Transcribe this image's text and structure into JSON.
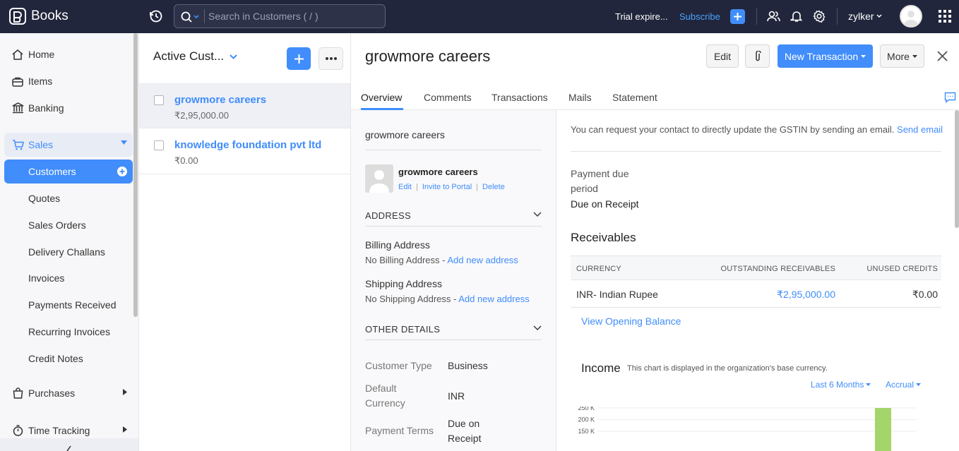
{
  "app": {
    "name": "Books"
  },
  "search": {
    "placeholder": "Search in Customers ( / )"
  },
  "header": {
    "trial": "Trial expire...",
    "subscribe": "Subscribe",
    "org": "zylker"
  },
  "sidebar": {
    "items": [
      {
        "label": "Home"
      },
      {
        "label": "Items"
      },
      {
        "label": "Banking"
      },
      {
        "label": "Sales"
      },
      {
        "label": "Customers"
      },
      {
        "label": "Quotes"
      },
      {
        "label": "Sales Orders"
      },
      {
        "label": "Delivery Challans"
      },
      {
        "label": "Invoices"
      },
      {
        "label": "Payments Received"
      },
      {
        "label": "Recurring Invoices"
      },
      {
        "label": "Credit Notes"
      },
      {
        "label": "Purchases"
      },
      {
        "label": "Time Tracking"
      }
    ]
  },
  "list": {
    "title": "Active Cust...",
    "rows": [
      {
        "name": "growmore careers",
        "amount": "₹2,95,000.00"
      },
      {
        "name": "knowledge foundation pvt ltd",
        "amount": "₹0.00"
      }
    ]
  },
  "detail": {
    "title": "growmore careers",
    "buttons": {
      "edit": "Edit",
      "new_transaction": "New Transaction",
      "more": "More"
    },
    "tabs": [
      "Overview",
      "Comments",
      "Transactions",
      "Mails",
      "Statement"
    ],
    "left": {
      "name": "growmore careers",
      "contact_name": "growmore careers",
      "contact_links": {
        "edit": "Edit",
        "invite": "Invite to Portal",
        "delete": "Delete"
      },
      "address_header": "ADDRESS",
      "billing_label": "Billing Address",
      "billing_text": "No Billing Address -",
      "shipping_label": "Shipping Address",
      "shipping_text": "No Shipping Address -",
      "add_new_address": "Add new address",
      "other_header": "OTHER DETAILS",
      "customer_type_label": "Customer Type",
      "customer_type": "Business",
      "default_currency_label": "Default Currency",
      "default_currency": "INR",
      "payment_terms_label": "Payment Terms",
      "payment_terms": "Due on Receipt"
    },
    "right": {
      "gstin_note": "You can request your contact to directly update the GSTIN by sending an email.",
      "send_email": "Send email",
      "payment_due_label": "Payment due period",
      "payment_due_value": "Due on Receipt",
      "receivables_title": "Receivables",
      "receivables_headers": [
        "CURRENCY",
        "OUTSTANDING RECEIVABLES",
        "UNUSED CREDITS"
      ],
      "receivables_row": {
        "currency": "INR- Indian Rupee",
        "outstanding": "₹2,95,000.00",
        "unused": "₹0.00"
      },
      "view_opening_balance": "View Opening Balance",
      "income_title": "Income",
      "income_note": "This chart is displayed in the organization's base currency.",
      "period_filter": "Last 6 Months",
      "basis_filter": "Accrual"
    }
  },
  "chart_data": {
    "type": "bar",
    "y_tick_labels": [
      "250 K",
      "200 K",
      "150 K"
    ],
    "ylim_visible": [
      150000,
      250000
    ],
    "bar_visible_top_value": 250000,
    "bar_color": "#a3d56b"
  }
}
